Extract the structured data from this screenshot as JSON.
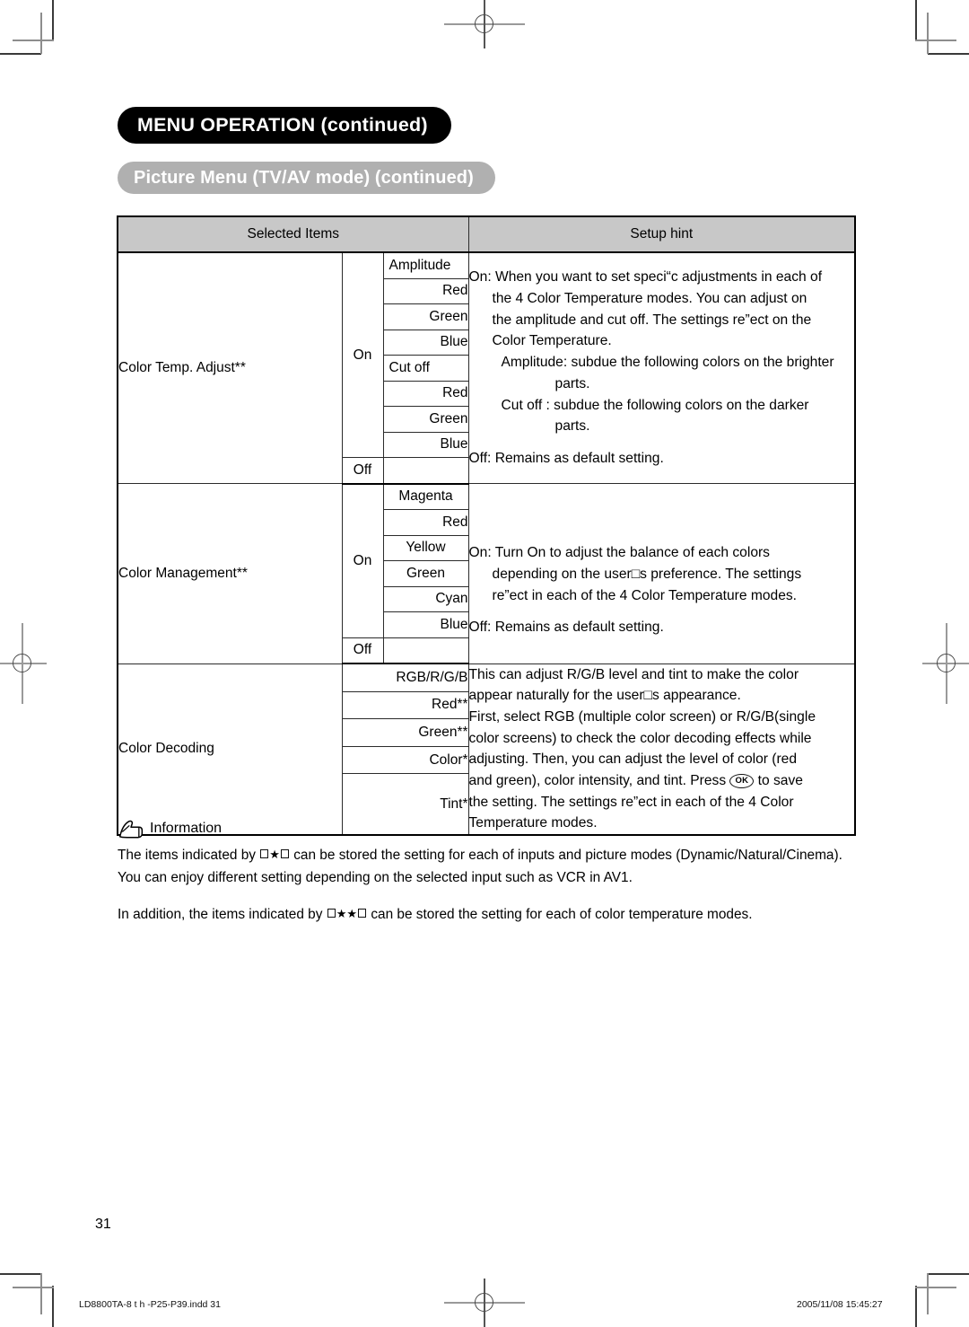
{
  "header": {
    "section_title": "MENU OPERATION (continued)",
    "subsection_title": "Picture Menu (TV/AV mode) (continued)"
  },
  "table": {
    "columns": [
      "Selected Items",
      "Setup hint"
    ],
    "rows": [
      {
        "item": "Color Temp. Adjust**",
        "state_on": "On",
        "state_off": "Off",
        "sub_items": [
          "Amplitude",
          "Red",
          "Green",
          "Blue",
          "Cut off",
          "Red",
          "Green",
          "Blue"
        ],
        "hint_lines": [
          "On: When you want to set speci“c adjustments in each of",
          "the 4 Color Temperature modes. You can adjust on",
          "the amplitude and cut off. The settings re”ect on the",
          "Color Temperature.",
          "Amplitude: subdue the following colors on the brighter",
          "parts.",
          "Cut off     : subdue the following colors on the darker",
          "parts.",
          "Off: Remains as default setting."
        ]
      },
      {
        "item": "Color Management**",
        "state_on": "On",
        "state_off": "Off",
        "sub_items": [
          "Magenta",
          "Red",
          "Yellow",
          "Green",
          "Cyan",
          "Blue"
        ],
        "hint_lines": [
          "On: Turn On to adjust the balance of each colors",
          "depending on the user□s preference. The settings",
          "re”ect in each of the 4 Color Temperature modes.",
          "Off: Remains as default setting."
        ]
      },
      {
        "item": "Color Decoding",
        "sub_items": [
          "RGB/R/G/B",
          "Red**",
          "Green**",
          "Color*",
          "Tint*"
        ],
        "hint_lines": [
          "This can adjust R/G/B level and tint to make the color",
          "appear naturally for the user□s appearance.",
          "First, select RGB (multiple color screen) or R/G/B(single",
          "color screens) to check the color decoding effects while",
          "adjusting. Then, you can adjust the level of color (red",
          "and green), color intensity, and tint. Press (OK) to save",
          "the setting. The settings re”ect in each of the 4 Color",
          "Temperature modes."
        ],
        "hint_key_label": "OK"
      }
    ]
  },
  "information": {
    "label": "Information",
    "line1_a": "The items indicated by",
    "line1_star": "★",
    "line1_b": "can be stored the setting for each of inputs and picture modes (Dynamic/Natural/Cinema).",
    "line2": "You can enjoy different setting depending on the selected input such as VCR in AV1.",
    "line3_a": "In addition, the items indicated by",
    "line3_star": "★★",
    "line3_b": "can be stored the setting for each of color temperature modes."
  },
  "page_number": "31",
  "footer": {
    "file": "LD8800TA-8 t  h -P25-P39.indd   31",
    "timestamp": "2005/11/08   15:45:27"
  },
  "colors": {
    "title_bg": "#000000",
    "subtitle_bg": "#b0b0b0",
    "header_cell_bg": "#c8c8c8"
  }
}
